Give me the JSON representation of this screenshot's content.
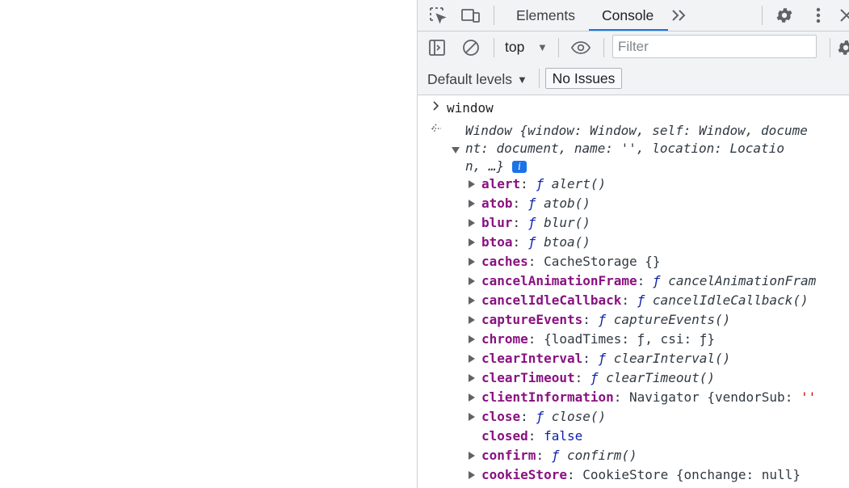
{
  "devtools": {
    "tabs": [
      {
        "label": "Elements",
        "active": false
      },
      {
        "label": "Console",
        "active": true
      }
    ],
    "icons": {
      "inspect": "select-element-icon",
      "device": "device-toolbar-icon",
      "more_tabs": "double-chevron-right-icon",
      "settings": "gear-icon",
      "menu": "kebab-menu-icon",
      "close": "close-icon"
    }
  },
  "toolbar": {
    "context": "top",
    "filter_placeholder": "Filter",
    "filter_value": "",
    "levels": "Default levels",
    "issues": "No Issues"
  },
  "console": {
    "input_command": "window",
    "result_summary": [
      "Window {window: Window, self: Window, docume",
      "nt: document, name: '', location: Locatio",
      "n, …}"
    ],
    "info_badge": "i",
    "properties": [
      {
        "name": "alert",
        "sep": ": ",
        "value": "ƒ alert()",
        "kind": "function",
        "expandable": true
      },
      {
        "name": "atob",
        "sep": ": ",
        "value": "ƒ atob()",
        "kind": "function",
        "expandable": true
      },
      {
        "name": "blur",
        "sep": ": ",
        "value": "ƒ blur()",
        "kind": "function",
        "expandable": true
      },
      {
        "name": "btoa",
        "sep": ": ",
        "value": "ƒ btoa()",
        "kind": "function",
        "expandable": true
      },
      {
        "name": "caches",
        "sep": ": ",
        "value": "CacheStorage {}",
        "kind": "object",
        "expandable": true
      },
      {
        "name": "cancelAnimationFrame",
        "sep": ": ",
        "value": "ƒ cancelAnimationFram",
        "kind": "function",
        "expandable": true
      },
      {
        "name": "cancelIdleCallback",
        "sep": ": ",
        "value": "ƒ cancelIdleCallback()",
        "kind": "function",
        "expandable": true
      },
      {
        "name": "captureEvents",
        "sep": ": ",
        "value": "ƒ captureEvents()",
        "kind": "function",
        "expandable": true
      },
      {
        "name": "chrome",
        "sep": ": ",
        "value": "{loadTimes: ƒ, csi: ƒ}",
        "kind": "object",
        "expandable": true
      },
      {
        "name": "clearInterval",
        "sep": ": ",
        "value": "ƒ clearInterval()",
        "kind": "function",
        "expandable": true
      },
      {
        "name": "clearTimeout",
        "sep": ": ",
        "value": "ƒ clearTimeout()",
        "kind": "function",
        "expandable": true
      },
      {
        "name": "clientInformation",
        "sep": ": ",
        "value": "Navigator {vendorSub: ''",
        "kind": "object",
        "expandable": true
      },
      {
        "name": "close",
        "sep": ": ",
        "value": "ƒ close()",
        "kind": "function",
        "expandable": true
      },
      {
        "name": "closed",
        "sep": ": ",
        "value": "false",
        "kind": "keyword",
        "expandable": false
      },
      {
        "name": "confirm",
        "sep": ": ",
        "value": "ƒ confirm()",
        "kind": "function",
        "expandable": true
      },
      {
        "name": "cookieStore",
        "sep": ": ",
        "value": "CookieStore {onchange: null}",
        "kind": "object",
        "expandable": true
      }
    ]
  }
}
